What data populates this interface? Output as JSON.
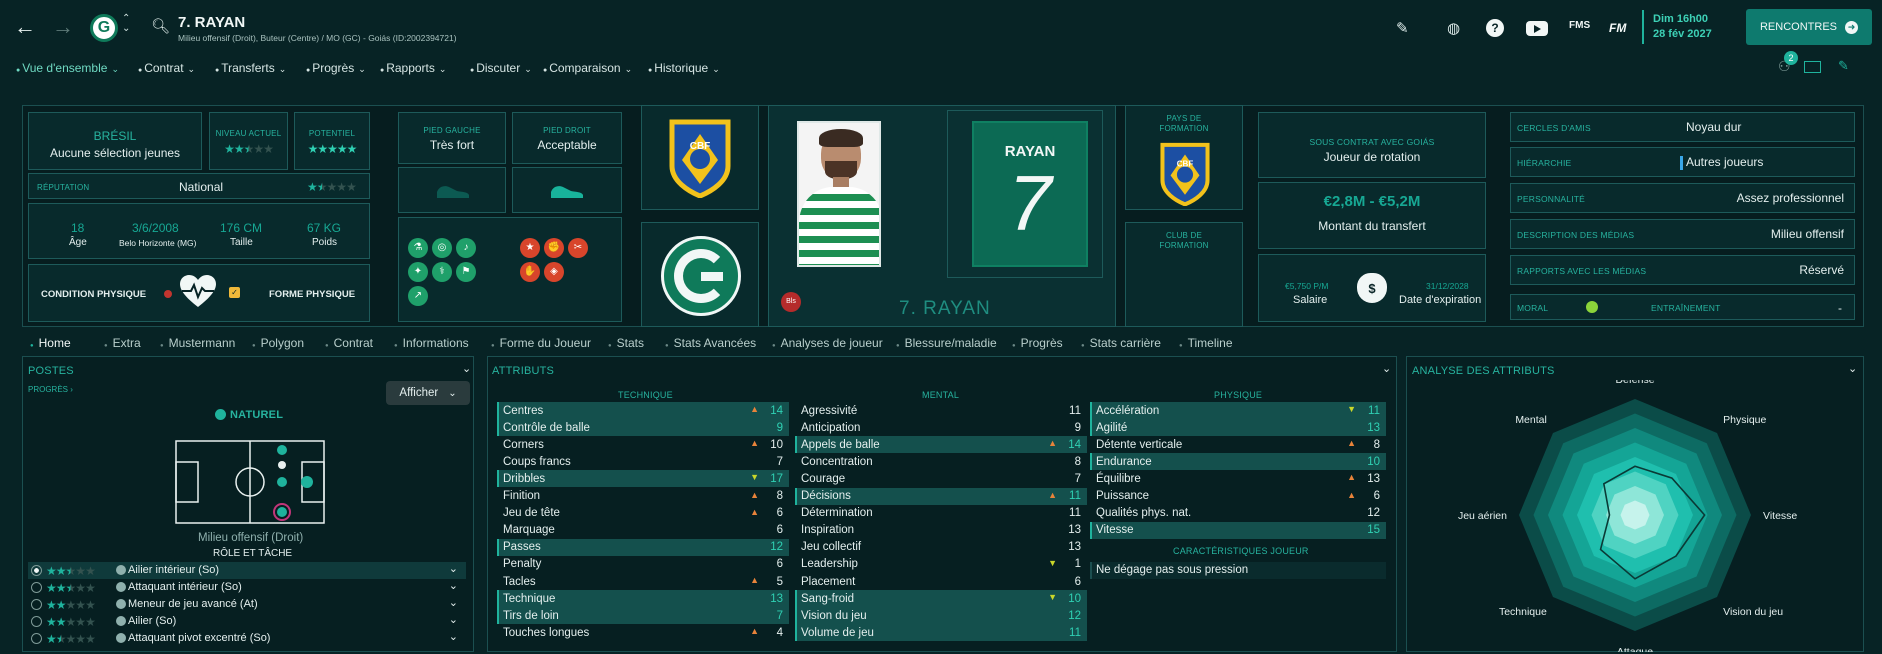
{
  "header": {
    "player_name": "7. RAYAN",
    "subtitle": "Milieu offensif (Droit), Buteur (Centre) / MO (GC) - Goiás (ID:2002394721)",
    "date_day": "Dim 16h00",
    "date": "28 fév 2027",
    "continue_label": "RENCONTRES",
    "notif_count": "2",
    "fms_label": "FMS",
    "fm_label": "FM"
  },
  "nav": [
    "Vue d'ensemble",
    "Contrat",
    "Transferts",
    "Progrès",
    "Rapports",
    "Discuter",
    "Comparaison",
    "Historique"
  ],
  "nation": {
    "name": "BRÉSIL",
    "caps": "Aucune sélection jeunes"
  },
  "ability": {
    "current_label": "NIVEAU ACTUEL",
    "potential_label": "POTENTIEL",
    "current_stars": 2.5,
    "potential_stars": 5
  },
  "reputation": {
    "label": "RÉPUTATION",
    "value": "National",
    "stars": 1.5
  },
  "bio": {
    "age": "18",
    "age_label": "Âge",
    "dob": "3/6/2008",
    "pob": "Belo Horizonte (MG)",
    "height": "176 CM",
    "height_label": "Taille",
    "weight": "67 KG",
    "weight_label": "Poids"
  },
  "condition": {
    "label": "CONDITION PHYSIQUE",
    "form_label": "FORME PHYSIQUE"
  },
  "feet": {
    "left_label": "PIED GAUCHE",
    "left": "Très fort",
    "right_label": "PIED DROIT",
    "right": "Acceptable"
  },
  "card": {
    "badge": "Bls",
    "name": "7. RAYAN",
    "shirt_name": "RAYAN",
    "shirt_number": "7",
    "cbf": "CBF"
  },
  "training": {
    "country_label": "PAYS DE FORMATION",
    "club_label": "CLUB DE FORMATION"
  },
  "contract": {
    "status_label": "SOUS CONTRAT AVEC GOIÁS",
    "role": "Joueur de rotation",
    "value_range": "€2,8M - €5,2M",
    "value_label": "Montant du transfert",
    "wage": "€5,750 P/M",
    "wage_label": "Salaire",
    "expiry": "31/12/2028",
    "expiry_label": "Date d'expiration"
  },
  "personal": [
    {
      "label": "CERCLES D'AMIS",
      "value": "Noyau dur"
    },
    {
      "label": "HIÉRARCHIE",
      "value": "Autres joueurs"
    },
    {
      "label": "PERSONNALITÉ",
      "value": "Assez professionnel"
    },
    {
      "label": "DESCRIPTION DES MÉDIAS",
      "value": "Milieu offensif"
    },
    {
      "label": "RAPPORTS AVEC LES MÉDIAS",
      "value": "Réservé"
    },
    {
      "label": "MORAL",
      "value": ""
    },
    {
      "label": "ENTRAÎNEMENT",
      "value": "-"
    }
  ],
  "tabs": [
    "Home",
    "Extra",
    "Mustermann",
    "Polygon",
    "Contrat",
    "Informations",
    "Forme du Joueur",
    "Stats",
    "Stats Avancées",
    "Analyses de joueur",
    "Blessure/maladie",
    "Progrès",
    "Stats carrière",
    "Timeline"
  ],
  "positions": {
    "title": "POSTES",
    "progress": "PROGRÈS",
    "show": "Afficher",
    "natural": "NATUREL",
    "role_name": "Milieu offensif (Droit)",
    "role_task": "RÔLE ET TÂCHE",
    "roles": [
      {
        "name": "Ailier intérieur (So)",
        "stars": 2.5
      },
      {
        "name": "Attaquant intérieur (So)",
        "stars": 2.5
      },
      {
        "name": "Meneur de jeu avancé (At)",
        "stars": 2
      },
      {
        "name": "Ailier (So)",
        "stars": 2
      },
      {
        "name": "Attaquant pivot excentré (So)",
        "stars": 1.5
      }
    ]
  },
  "attributes": {
    "title": "ATTRIBUTS",
    "technical_label": "TECHNIQUE",
    "mental_label": "MENTAL",
    "physical_label": "PHYSIQUE",
    "traits_label": "CARACTÉRISTIQUES JOUEUR",
    "trait": "Ne dégage pas sous pression",
    "technical": [
      {
        "name": "Centres",
        "value": "14",
        "hl": true,
        "arrow": "up"
      },
      {
        "name": "Contrôle de balle",
        "value": "9",
        "hl": true,
        "arrow": ""
      },
      {
        "name": "Corners",
        "value": "10",
        "hl": false,
        "arrow": "up"
      },
      {
        "name": "Coups francs",
        "value": "7",
        "hl": false,
        "arrow": ""
      },
      {
        "name": "Dribbles",
        "value": "17",
        "hl": true,
        "arrow": "down"
      },
      {
        "name": "Finition",
        "value": "8",
        "hl": false,
        "arrow": "up"
      },
      {
        "name": "Jeu de tête",
        "value": "6",
        "hl": false,
        "arrow": "up"
      },
      {
        "name": "Marquage",
        "value": "6",
        "hl": false,
        "arrow": ""
      },
      {
        "name": "Passes",
        "value": "12",
        "hl": true,
        "arrow": ""
      },
      {
        "name": "Penalty",
        "value": "6",
        "hl": false,
        "arrow": ""
      },
      {
        "name": "Tacles",
        "value": "5",
        "hl": false,
        "arrow": "up"
      },
      {
        "name": "Technique",
        "value": "13",
        "hl": true,
        "arrow": ""
      },
      {
        "name": "Tirs de loin",
        "value": "7",
        "hl": true,
        "arrow": ""
      },
      {
        "name": "Touches longues",
        "value": "4",
        "hl": false,
        "arrow": "up"
      }
    ],
    "mental": [
      {
        "name": "Agressivité",
        "value": "11",
        "hl": false,
        "arrow": ""
      },
      {
        "name": "Anticipation",
        "value": "9",
        "hl": false,
        "arrow": ""
      },
      {
        "name": "Appels de balle",
        "value": "14",
        "hl": true,
        "arrow": "up"
      },
      {
        "name": "Concentration",
        "value": "8",
        "hl": false,
        "arrow": ""
      },
      {
        "name": "Courage",
        "value": "7",
        "hl": false,
        "arrow": ""
      },
      {
        "name": "Décisions",
        "value": "11",
        "hl": true,
        "arrow": "up"
      },
      {
        "name": "Détermination",
        "value": "11",
        "hl": false,
        "arrow": ""
      },
      {
        "name": "Inspiration",
        "value": "13",
        "hl": false,
        "arrow": ""
      },
      {
        "name": "Jeu collectif",
        "value": "13",
        "hl": false,
        "arrow": ""
      },
      {
        "name": "Leadership",
        "value": "1",
        "hl": false,
        "arrow": "down"
      },
      {
        "name": "Placement",
        "value": "6",
        "hl": false,
        "arrow": ""
      },
      {
        "name": "Sang-froid",
        "value": "10",
        "hl": true,
        "arrow": "down"
      },
      {
        "name": "Vision du jeu",
        "value": "12",
        "hl": true,
        "arrow": ""
      },
      {
        "name": "Volume de jeu",
        "value": "11",
        "hl": true,
        "arrow": ""
      }
    ],
    "physical": [
      {
        "name": "Accélération",
        "value": "11",
        "hl": true,
        "arrow": "down"
      },
      {
        "name": "Agilité",
        "value": "13",
        "hl": true,
        "arrow": ""
      },
      {
        "name": "Détente verticale",
        "value": "8",
        "hl": false,
        "arrow": "up"
      },
      {
        "name": "Endurance",
        "value": "10",
        "hl": true,
        "arrow": ""
      },
      {
        "name": "Équilibre",
        "value": "13",
        "hl": false,
        "arrow": "up"
      },
      {
        "name": "Puissance",
        "value": "6",
        "hl": false,
        "arrow": "up"
      },
      {
        "name": "Qualités phys. nat.",
        "value": "12",
        "hl": false,
        "arrow": ""
      },
      {
        "name": "Vitesse",
        "value": "15",
        "hl": true,
        "arrow": ""
      }
    ]
  },
  "radar": {
    "title": "ANALYSE DES ATTRIBUTS",
    "labels": [
      "Défense",
      "Physique",
      "Vitesse",
      "Vision du jeu",
      "Attaque",
      "Technique",
      "Jeu aérien",
      "Mental"
    ],
    "values": [
      0.42,
      0.45,
      0.6,
      0.5,
      0.55,
      0.42,
      0.22,
      0.38
    ]
  },
  "colors": {
    "bg": "#072325",
    "accent": "#1fb39d",
    "button": "#0e7a6e",
    "arrow_up": "#e8833a",
    "arrow_down": "#c9d72a"
  }
}
